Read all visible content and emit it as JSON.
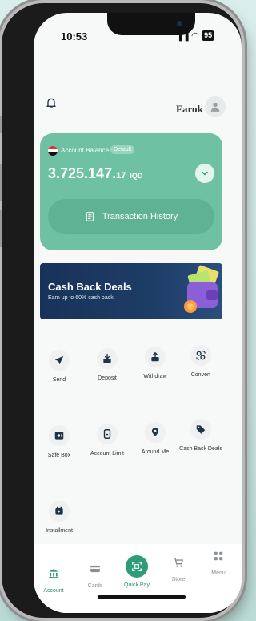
{
  "status_bar": {
    "time": "10:53",
    "signal": "▐▐",
    "wifi": "◠",
    "battery": "95"
  },
  "header": {
    "username": "Farok"
  },
  "balance": {
    "label": "Account Balance",
    "badge": "Default",
    "amount_int": "3.725.147.",
    "amount_dec": "17",
    "currency": "IQD",
    "history_button": "Transaction History"
  },
  "promo": {
    "title": "Cash Back Deals",
    "subtitle": "Earn up to 60% cash back"
  },
  "actions": [
    {
      "label": "Send",
      "icon": "send-icon"
    },
    {
      "label": "Deposit",
      "icon": "deposit-icon"
    },
    {
      "label": "Withdraw",
      "icon": "withdraw-icon"
    },
    {
      "label": "Convert",
      "icon": "convert-icon"
    },
    {
      "label": "Safe Box",
      "icon": "safe-box-icon"
    },
    {
      "label": "Account Limit",
      "icon": "account-limit-icon"
    },
    {
      "label": "Around Me",
      "icon": "location-icon"
    },
    {
      "label": "Cash Back Deals",
      "icon": "tag-icon"
    },
    {
      "label": "Installment",
      "icon": "installment-icon"
    }
  ],
  "tabs": [
    {
      "label": "Account",
      "icon": "bank-icon",
      "active": true
    },
    {
      "label": "Cards",
      "icon": "card-icon",
      "active": false
    },
    {
      "label": "Quick Pay",
      "icon": "qr-icon",
      "active": true
    },
    {
      "label": "Store",
      "icon": "cart-icon",
      "active": false
    },
    {
      "label": "Menu",
      "icon": "grid-icon",
      "active": false
    }
  ],
  "colors": {
    "accent": "#6fc1a3",
    "accent_dark": "#2e9c78",
    "promo_bg": "#1d3c66",
    "icon_dark": "#1f3545"
  }
}
